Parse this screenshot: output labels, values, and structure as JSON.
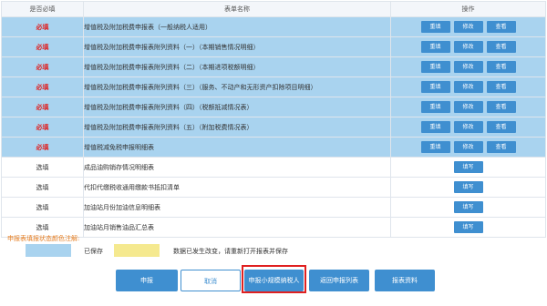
{
  "table": {
    "headers": [
      "是否必填",
      "表单名称",
      "操作"
    ],
    "rows": [
      {
        "req": "必填",
        "name": "增值税及附加税费申报表（一般纳税人适用）",
        "ops": [
          "重填",
          "修改",
          "查看"
        ],
        "state": "saved",
        "mandatory": true
      },
      {
        "req": "必填",
        "name": "增值税及附加税费申报表附列资料（一）（本期销售情况明细）",
        "ops": [
          "重填",
          "修改",
          "查看"
        ],
        "state": "saved",
        "mandatory": true
      },
      {
        "req": "必填",
        "name": "增值税及附加税费申报表附列资料（二）（本期进项税额明细）",
        "ops": [
          "重填",
          "修改",
          "查看"
        ],
        "state": "saved",
        "mandatory": true
      },
      {
        "req": "必填",
        "name": "增值税及附加税费申报表附列资料（三）（服务、不动产和无形资产扣除项目明细）",
        "ops": [
          "重填",
          "修改",
          "查看"
        ],
        "state": "saved",
        "mandatory": true
      },
      {
        "req": "必填",
        "name": "增值税及附加税费申报表附列资料（四）（税额抵减情况表）",
        "ops": [
          "重填",
          "修改",
          "查看"
        ],
        "state": "saved",
        "mandatory": true
      },
      {
        "req": "必填",
        "name": "增值税及附加税费申报表附列资料（五）（附加税费情况表）",
        "ops": [
          "重填",
          "修改",
          "查看"
        ],
        "state": "saved",
        "mandatory": true
      },
      {
        "req": "必填",
        "name": "增值税减免税申报明细表",
        "ops": [
          "重填",
          "修改",
          "查看"
        ],
        "state": "saved",
        "mandatory": true
      },
      {
        "req": "选填",
        "name": "成品油购销存情况明细表",
        "ops": [
          "填写"
        ],
        "state": "plain",
        "mandatory": false
      },
      {
        "req": "选填",
        "name": "代扣代缴税收通用缴款书抵扣清单",
        "ops": [
          "填写"
        ],
        "state": "plain",
        "mandatory": false
      },
      {
        "req": "选填",
        "name": "加油站月份加油信息明细表",
        "ops": [
          "填写"
        ],
        "state": "plain",
        "mandatory": false
      },
      {
        "req": "选填",
        "name": "加油站月销售油品汇总表",
        "ops": [
          "填写"
        ],
        "state": "plain",
        "mandatory": false
      }
    ]
  },
  "legend": {
    "title": "申报表填报状态颜色注解:",
    "saved_label": "已保存",
    "changed_label": "数据已发生改变，请重新打开报表并保存",
    "saved_color": "#a9d3ef",
    "changed_color": "#f5e98f"
  },
  "buttons": [
    "申报",
    "取消",
    "申报小规模纳税人",
    "返回申报列表",
    "报表资料"
  ],
  "colors": {
    "accent": "#3f8fd0",
    "mandatory": "#e02020",
    "legend_title": "#e67e22",
    "highlight": "#e02020"
  }
}
